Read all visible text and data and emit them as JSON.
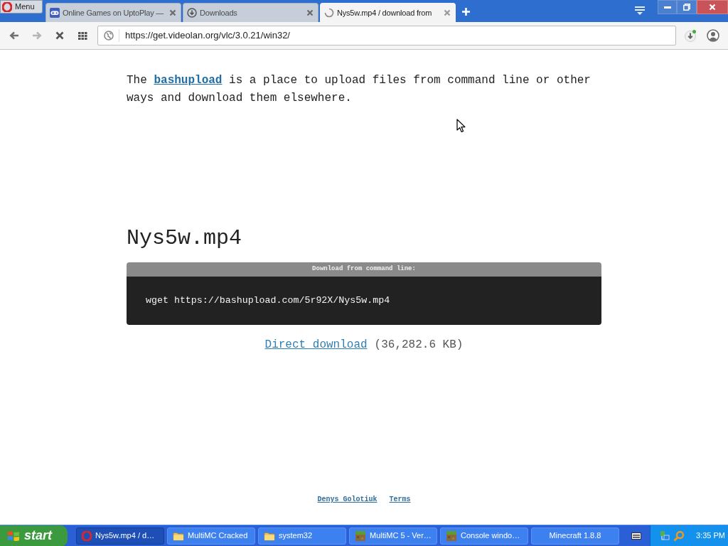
{
  "browser": {
    "menu_button": "Menu",
    "tabs": [
      {
        "title": "Online Games on UptoPlay —",
        "selected": false,
        "kind": "site"
      },
      {
        "title": "Downloads",
        "selected": false,
        "kind": "downloads"
      },
      {
        "title": "Nys5w.mp4 / download from",
        "selected": true,
        "kind": "loading"
      }
    ],
    "address_bar": {
      "url": "https://get.videolan.org/vlc/3.0.21/win32/"
    }
  },
  "page": {
    "intro": {
      "before": "The",
      "link": "bashupload",
      "after": "is a place to upload files from command line or other ways and download them elsewhere."
    },
    "file_name": "Nys5w.mp4",
    "command_box": {
      "title": "Download from command line:",
      "command": "wget https://bashupload.com/5r92X/Nys5w.mp4"
    },
    "direct_download": {
      "link": "Direct download",
      "size": "(36,282.6 KB)"
    },
    "footer_links": [
      "Denys Golotiuk",
      "Terms"
    ]
  },
  "taskbar": {
    "start": "start",
    "tasks": [
      {
        "label": "Nys5w.mp4 / d…",
        "selected": true,
        "kind": "browser"
      },
      {
        "label": "MultiMC Cracked",
        "selected": false,
        "kind": "folder"
      },
      {
        "label": "system32",
        "selected": false,
        "kind": "folder"
      },
      {
        "label": "MultiMC 5 - Ver…",
        "selected": false,
        "kind": "block"
      },
      {
        "label": "Console windo…",
        "selected": false,
        "kind": "block"
      },
      {
        "label": "Minecraft 1.8.8",
        "selected": false,
        "kind": "plain"
      }
    ],
    "clock": "3:35 PM"
  }
}
